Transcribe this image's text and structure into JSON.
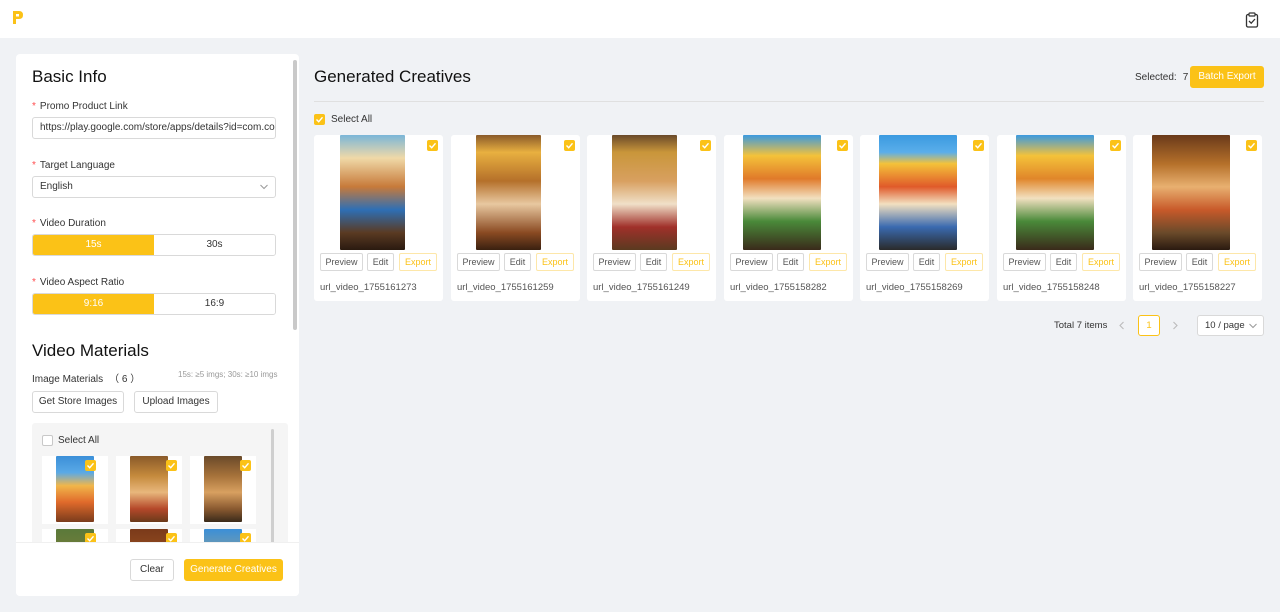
{
  "colors": {
    "accent": "#fbc217",
    "required": "#ff4d4f",
    "background": "#f0f2f5"
  },
  "header": {
    "logo_icon": "brand-p-logo",
    "task_icon": "clipboard-check-icon"
  },
  "basic_info": {
    "title": "Basic Info",
    "promo_link": {
      "label": "Promo Product Link",
      "value": "https://play.google.com/store/apps/details?id=com.coc"
    },
    "target_language": {
      "label": "Target Language",
      "value": "English"
    },
    "video_duration": {
      "label": "Video Duration",
      "options": [
        "15s",
        "30s"
      ],
      "selected": "15s"
    },
    "aspect_ratio": {
      "label": "Video Aspect Ratio",
      "options": [
        "9:16",
        "16:9"
      ],
      "selected": "9:16"
    }
  },
  "video_materials": {
    "title": "Video Materials",
    "image_materials_label": "Image Materials",
    "image_count": "（ 6 ）",
    "hint": "15s: ≥5 imgs; 30s: ≥10 imgs",
    "get_store_images": "Get Store Images",
    "upload_images": "Upload Images",
    "select_all": "Select All"
  },
  "footer": {
    "clear": "Clear",
    "generate": "Generate Creatives"
  },
  "generated": {
    "title": "Generated Creatives",
    "selected_label": "Selected:",
    "selected_count": "7",
    "batch_export": "Batch Export",
    "select_all": "Select All",
    "btn_preview": "Preview",
    "btn_edit": "Edit",
    "btn_export": "Export",
    "cards": [
      {
        "name": "url_video_1755161273"
      },
      {
        "name": "url_video_1755161259"
      },
      {
        "name": "url_video_1755161249"
      },
      {
        "name": "url_video_1755158282"
      },
      {
        "name": "url_video_1755158269"
      },
      {
        "name": "url_video_1755158248"
      },
      {
        "name": "url_video_1755158227"
      }
    ]
  },
  "pagination": {
    "total": "Total 7 items",
    "current_page": "1",
    "page_size": "10 / page"
  }
}
